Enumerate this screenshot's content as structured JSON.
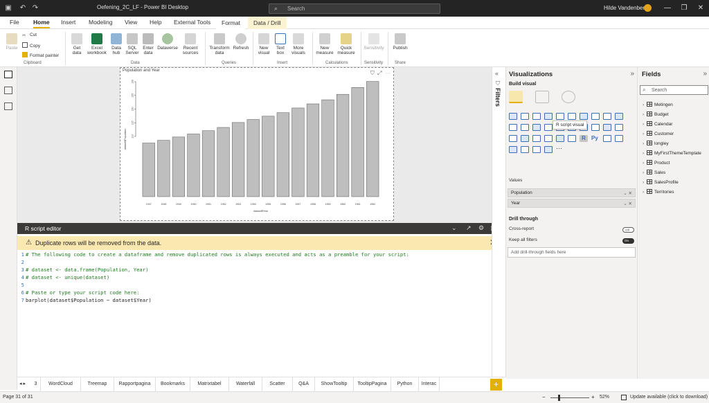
{
  "titlebar": {
    "document_title": "Oefening_2C_LF - Power BI Desktop",
    "search_placeholder": "Search",
    "user_name": "Hilde Vandenberk"
  },
  "ribbon_tabs": [
    {
      "label": "File"
    },
    {
      "label": "Home"
    },
    {
      "label": "Insert"
    },
    {
      "label": "Modeling"
    },
    {
      "label": "View"
    },
    {
      "label": "Help"
    },
    {
      "label": "External Tools"
    },
    {
      "label": "Format"
    },
    {
      "label": "Data / Drill"
    }
  ],
  "ribbon": {
    "clipboard": {
      "paste": "Paste",
      "cut": "Cut",
      "copy": "Copy",
      "format_painter": "Format painter",
      "group": "Clipboard"
    },
    "data": {
      "get_data": "Get data",
      "excel": "Excel workbook",
      "data_hub": "Data hub",
      "sql": "SQL Server",
      "enter_data": "Enter data",
      "dataverse": "Dataverse",
      "recent": "Recent sources",
      "group": "Data"
    },
    "queries": {
      "transform": "Transform data",
      "refresh": "Refresh",
      "group": "Queries"
    },
    "insert": {
      "new_visual": "New visual",
      "text_box": "Text box",
      "more_visuals": "More visuals",
      "group": "Insert"
    },
    "calculations": {
      "new_measure": "New measure",
      "quick_measure": "Quick measure",
      "group": "Calculations"
    },
    "sensitivity": {
      "label": "Sensitivity",
      "group": "Sensitivity"
    },
    "share": {
      "publish": "Publish",
      "group": "Share"
    }
  },
  "visual": {
    "title": "Population and Year"
  },
  "chart_data": {
    "type": "bar",
    "categories": [
      "1947",
      "1948",
      "1949",
      "1950",
      "1951",
      "1952",
      "1953",
      "1954",
      "1955",
      "1956",
      "1957",
      "1958",
      "1959",
      "1960",
      "1961",
      "1962"
    ],
    "values": [
      107.6,
      108.6,
      109.8,
      110.9,
      112.1,
      113.3,
      115.1,
      116.2,
      117.4,
      118.7,
      120.4,
      121.9,
      123.4,
      125.4,
      127.9,
      130.1
    ],
    "yticks": [
      "110",
      "115",
      "120",
      "125",
      "130"
    ],
    "xlabel": "dataset$Year",
    "ylabel": "dataset$Population",
    "ylim": [
      88,
      130
    ]
  },
  "r_editor": {
    "title": "R script editor",
    "warning": "Duplicate rows will be removed from the data.",
    "lines": [
      {
        "num": "1",
        "text": "# The following code to create a dataframe and remove duplicated rows is always executed and acts as a preamble for your script:",
        "comment": true
      },
      {
        "num": "2",
        "text": "",
        "comment": true
      },
      {
        "num": "3",
        "text": "# dataset <- data.frame(Population, Year)",
        "comment": true
      },
      {
        "num": "4",
        "text": "# dataset <- unique(dataset)",
        "comment": true
      },
      {
        "num": "5",
        "text": "",
        "comment": true
      },
      {
        "num": "6",
        "text": "# Paste or type your script code here:",
        "comment": true
      },
      {
        "num": "7",
        "text": "barplot(dataset$Population ~ dataset$Year)",
        "comment": false
      }
    ]
  },
  "filters": {
    "label": "Filters"
  },
  "visualizations": {
    "title": "Visualizations",
    "build_visual": "Build visual",
    "tooltip": "R script visual",
    "values_label": "Values",
    "wells": [
      "Population",
      "Year"
    ],
    "drill_through": "Drill through",
    "cross_report": "Cross-report",
    "cross_report_state": "Off",
    "keep_filters": "Keep all filters",
    "keep_filters_state": "On",
    "add_drill": "Add drill-through fields here"
  },
  "fields": {
    "title": "Fields",
    "search_placeholder": "Search",
    "tables": [
      "Metingen",
      "Budget",
      "Calendar",
      "Customer",
      "longley",
      "MyFirstThemeTemplate",
      "Product",
      "Sales",
      "SalesProfile",
      "Territories"
    ]
  },
  "page_tabs": [
    "3",
    "WordCloud",
    "Treemap",
    "Rapportpagina",
    "Bookmarks",
    "Matrixtabel",
    "Waterfall",
    "Scatter",
    "Q&A",
    "ShowTooltip",
    "TooltipPagina",
    "Python",
    "Interac"
  ],
  "status": {
    "page": "Page 31 of 31",
    "zoom": "52%",
    "update": "Update available (click to download)"
  },
  "colors": {
    "accent": "#e2b007",
    "bar": "#bebebe",
    "titlebar": "#242424"
  }
}
